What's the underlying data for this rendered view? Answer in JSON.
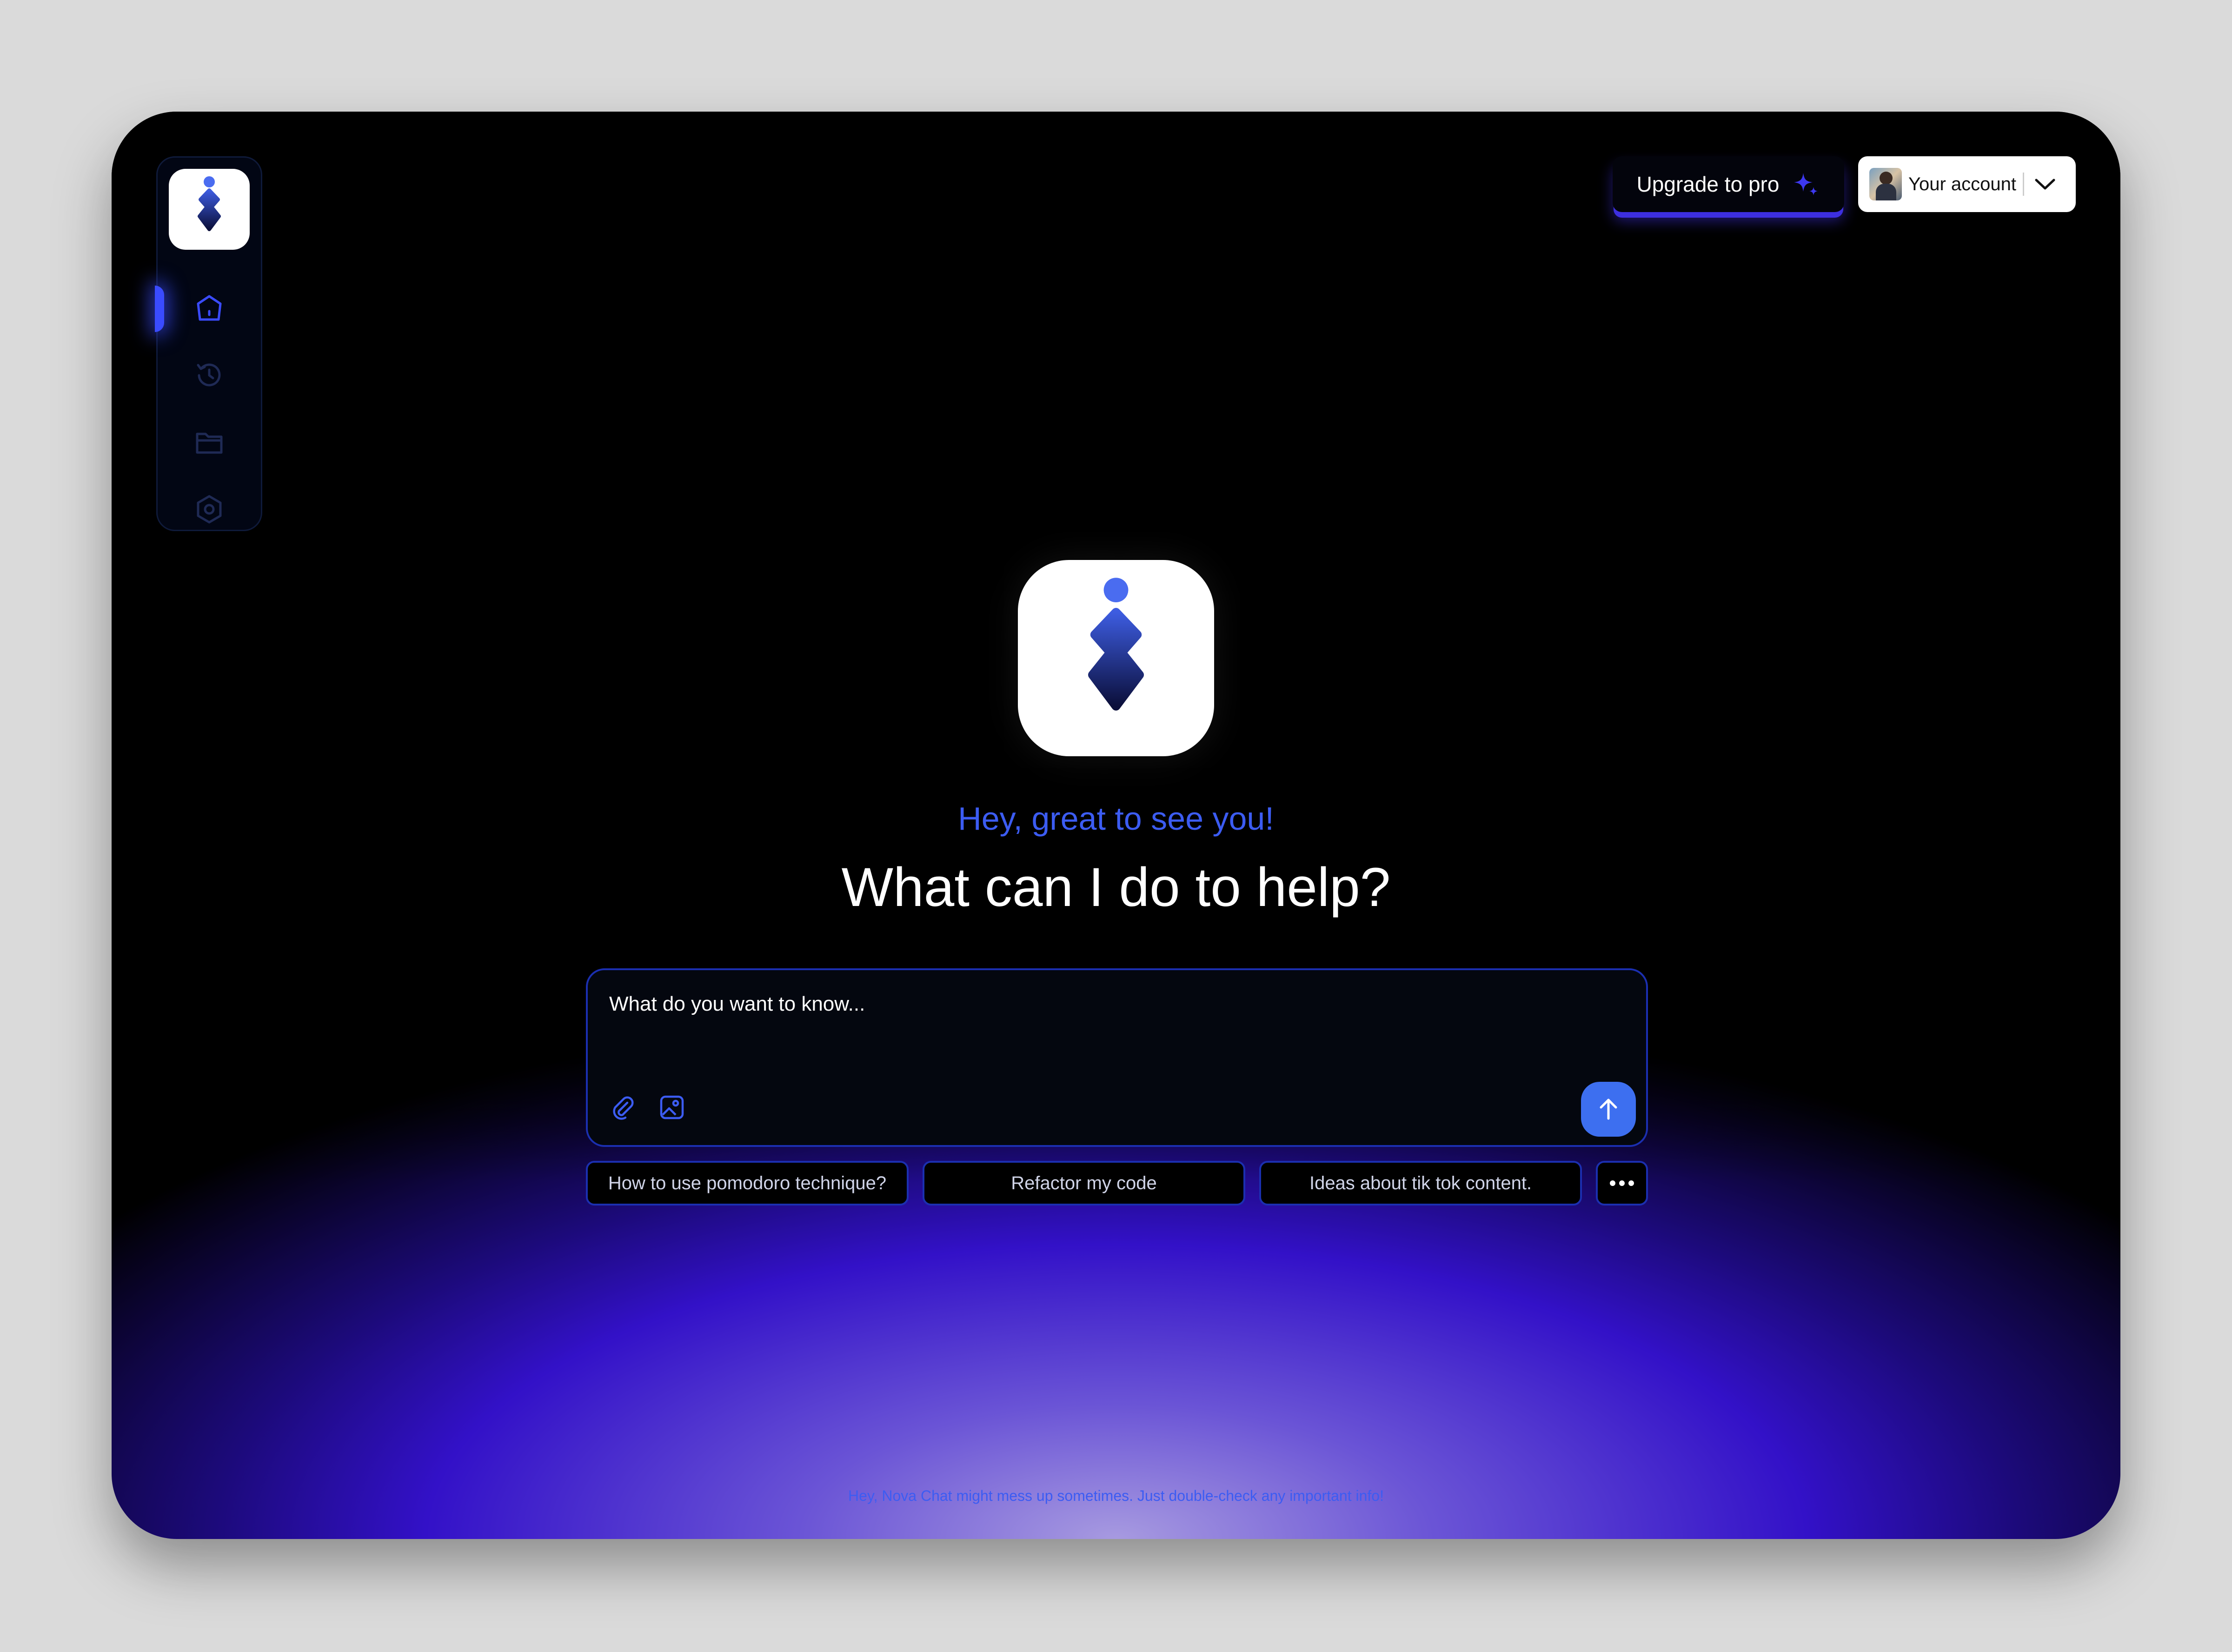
{
  "app": {
    "name": "Nova Chat"
  },
  "header": {
    "upgrade_label": "Upgrade to pro",
    "account_label": "Your account"
  },
  "sidebar": {
    "items": [
      {
        "name": "home",
        "icon": "home-icon",
        "active": true
      },
      {
        "name": "history",
        "icon": "history-icon",
        "active": false
      },
      {
        "name": "folder",
        "icon": "folder-icon",
        "active": false
      },
      {
        "name": "settings",
        "icon": "settings-icon",
        "active": false
      }
    ]
  },
  "main": {
    "greeting": "Hey, great to see you!",
    "headline": "What can I do to help?",
    "input_placeholder": "What do you want to know...",
    "suggestions": [
      "How to use pomodoro technique?",
      "Refactor my code",
      "Ideas about tik tok content."
    ],
    "more_icon": "more-dots-icon"
  },
  "footer": {
    "disclaimer": "Hey, Nova Chat might mess up sometimes. Just double-check any important info!"
  },
  "colors": {
    "accent": "#3c5cf2",
    "send_button": "#3d6ff0",
    "background": "#000000",
    "glow": "#3311c8"
  }
}
